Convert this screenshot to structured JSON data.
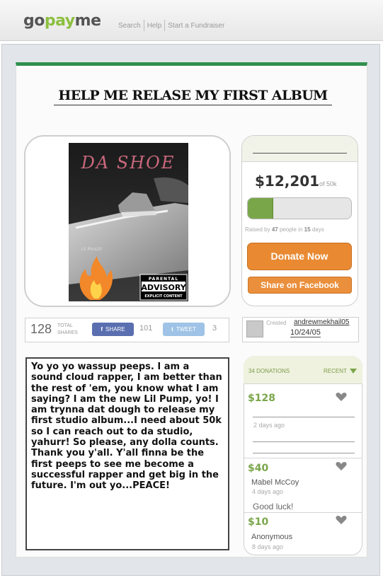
{
  "header": {
    "logo_go": "go",
    "logo_pay": "pay",
    "logo_me": "me",
    "nav": [
      "Search",
      "Help",
      "Start a Fundraiser"
    ]
  },
  "campaign": {
    "title": "HELP ME RELASE MY FIRST ALBUM",
    "cover": {
      "title": "DA SHOE",
      "artist": "Lil Pino20",
      "advisory_top": "PARENTAL",
      "advisory_mid": "ADVISORY",
      "advisory_bot": "EXPLICIT CONTENT"
    }
  },
  "funding": {
    "raised": "$12,201",
    "goal": "of 50k",
    "progress_fraction": 0.244,
    "raised_by_prefix": "Raised by",
    "people": "47",
    "people_in": "people in",
    "days": "15",
    "days_suffix": "days",
    "donate_label": "Donate Now",
    "share_fb_label": "Share on Facebook"
  },
  "shares": {
    "total": "128",
    "total_label_1": "TOTAL",
    "total_label_2": "SHARES",
    "fb_label": "SHARE",
    "fb_count": "101",
    "tw_label": "TWEET",
    "tw_count": "3"
  },
  "creator": {
    "created_label": "Created",
    "name": "andrewmekhail05",
    "date": "10/24/05"
  },
  "story": "Yo yo yo wassup peeps. I am a sound cloud rapper, I am better than the rest of 'em, you know what I am saying? I am the new Lil Pump, yo! I am trynna dat dough to release my first studio album...I need about 50k so I can reach out to da studio, yahurr! So please, any dolla counts.  Thank you y'all. Y'all finna be the first peeps to see me become a successful rapper and get big in the future. I'm out yo...PEACE!",
  "donations": {
    "count_label": "34 DONATIONS",
    "sort_label": "RECENT",
    "items": [
      {
        "amount": "$128",
        "name": "",
        "ago": "2 days ago",
        "message": ""
      },
      {
        "amount": "$40",
        "name": "Mabel McCoy",
        "ago": "4 days ago",
        "message": "Good luck!"
      },
      {
        "amount": "$10",
        "name": "Anonymous",
        "ago": "8 days ago",
        "message": ""
      }
    ]
  },
  "colors": {
    "brand_green": "#8cbf3f",
    "accent_orange": "#e98a32",
    "header_bar": "#2f8f4e"
  }
}
